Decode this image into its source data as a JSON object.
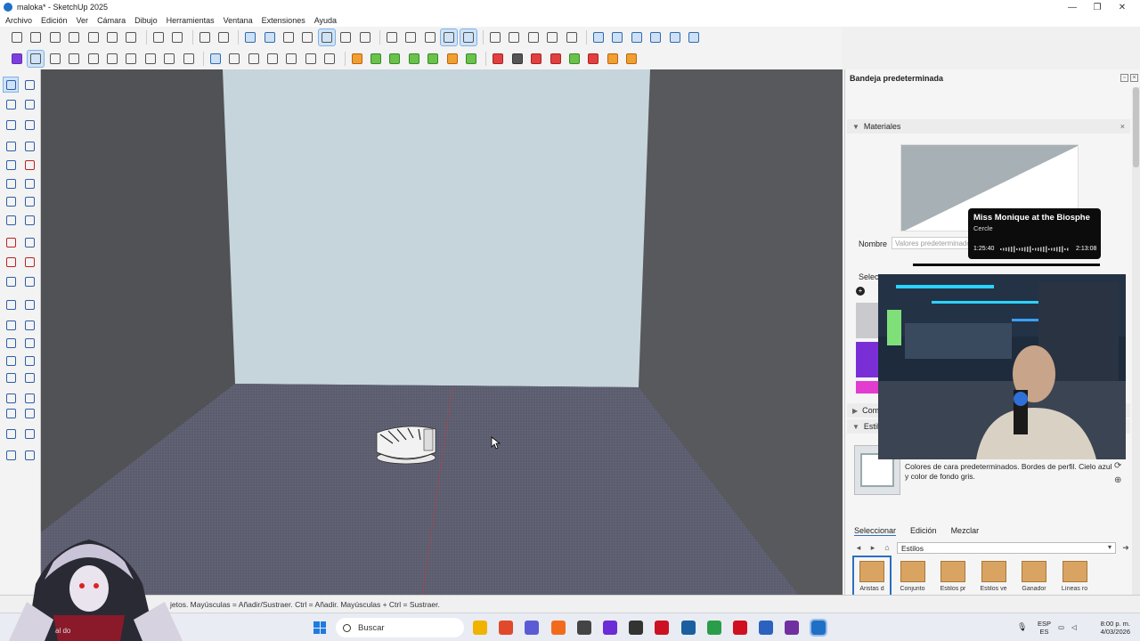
{
  "window": {
    "title": "maloka* - SketchUp 2025",
    "controls": [
      "—",
      "❐",
      "✕"
    ]
  },
  "menu": [
    "Archivo",
    "Edición",
    "Ver",
    "Cámara",
    "Dibujo",
    "Herramientas",
    "Ventana",
    "Extensiones",
    "Ayuda"
  ],
  "tray": {
    "title": "Bandeja predeterminada",
    "materials": {
      "header": "Materiales",
      "name_label": "Nombre",
      "name_placeholder": "Valores predeterminados",
      "select_label": "Selec",
      "material_colors": [
        "#c9c9ce",
        "#7a2fd6",
        "#e23cd0"
      ]
    },
    "components": {
      "header": "Comp"
    },
    "styles": {
      "header": "Estil",
      "description": "Colores de cara predeterminados. Bordes de perfil. Cielo azul y color de fondo gris.",
      "tabs": [
        "Seleccionar",
        "Edición",
        "Mezclar"
      ],
      "active_tab": "Seleccionar",
      "collection": "Estilos",
      "items": [
        "Aristas d",
        "Conjunto",
        "Estilos pr",
        "Estilos ve",
        "Ganador",
        "Líneas ro"
      ]
    }
  },
  "status": {
    "text": "jetos. Mayúsculas = Añadir/Sustraer. Ctrl = Añadir. Mayúsculas + Ctrl = Sustraer."
  },
  "media": {
    "title": "Miss Monique at the Biosphe",
    "artist": "Cercle",
    "elapsed": "1:25:40",
    "total": "2:13:08",
    "progress": 0.64
  },
  "taskbar": {
    "search_placeholder": "Buscar",
    "language_top": "ESP",
    "language_bottom": "ES",
    "clock_time": "8:00 p. m.",
    "clock_date": "4/03/2026",
    "avatar_caption": "al do",
    "app_colors": [
      "#f0b400",
      "#e04a2a",
      "#5b5bd6",
      "#f26b1d",
      "#444444",
      "#6b2bd6",
      "#333333",
      "#cc1122",
      "#1b5fa0",
      "#2a9d4a",
      "#d01020",
      "#2b62c0",
      "#7030a0",
      "#1f6fc5"
    ]
  },
  "colors": {
    "sky_wall": "#c6d5dc",
    "floor": "#5f6173",
    "side_wall": "#57595d",
    "accent": "#2d6fc0"
  },
  "icons": {
    "toolbar_row1": [
      "new-file-icon",
      "open-icon",
      "save-icon",
      "cut-icon",
      "copy-icon",
      "paste-icon",
      "erase-icon",
      "undo-icon",
      "redo-icon",
      "print-icon",
      "model-info-icon",
      "xray-icon",
      "back-edges-icon",
      "wireframe-icon",
      "hidden-line-icon",
      "shaded-icon",
      "shaded-texture-icon",
      "monochrome-icon",
      "orbit-icon",
      "pan-icon",
      "zoom-icon",
      "zoom-extents-icon",
      "iso-view-icon",
      "top-view-icon",
      "front-view-icon",
      "right-view-icon",
      "back-view-icon",
      "left-view-icon",
      "section-plane-icon",
      "section-display-icon",
      "section-cut-icon",
      "section-fill-icon",
      "section-edges-icon",
      "section-toggle-icon"
    ],
    "toolbar_row2": [
      "extension-icon",
      "perspective-icon",
      "camera-icon",
      "video-icon",
      "walk-icon",
      "look-around-icon",
      "position-camera-icon",
      "warehouse-icon",
      "share-icon",
      "help-icon",
      "sandbox-smoove-icon",
      "sandbox-stamp-icon",
      "sandbox-drape-icon",
      "sandbox-add-detail-icon",
      "sandbox-flip-edge-icon",
      "sandbox-from-contours-icon",
      "sandbox-from-scratch-icon",
      "solid-outer-shell-icon",
      "solid-intersect-icon",
      "solid-union-icon",
      "solid-subtract-icon",
      "solid-trim-icon",
      "solid-split-icon",
      "solid-inspector-icon",
      "axis-tool-icon",
      "red-axis-icon",
      "green-axis-icon",
      "blue-axis-icon",
      "north-icon",
      "south-icon",
      "east-icon",
      "west-icon"
    ]
  }
}
